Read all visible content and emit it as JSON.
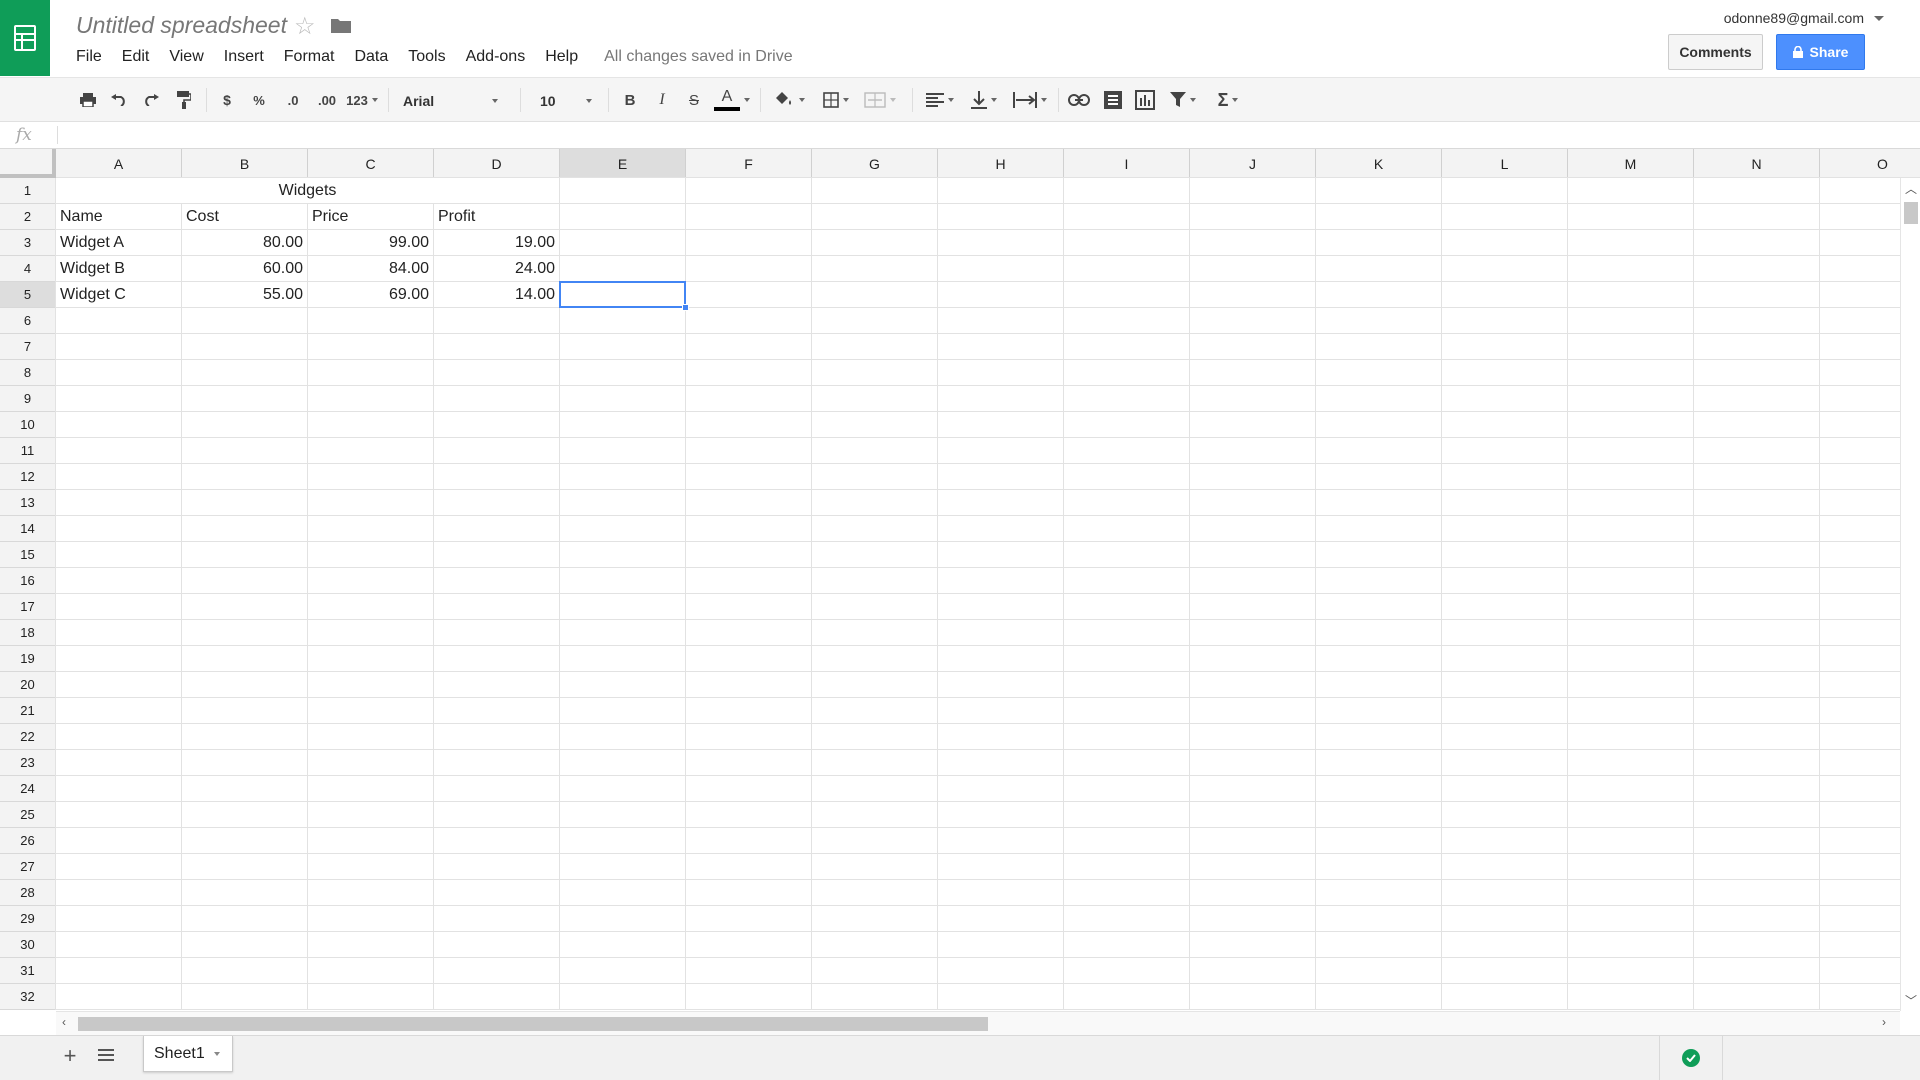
{
  "app": {
    "title": "Untitled spreadsheet",
    "save_status": "All changes saved in Drive",
    "account": "odonne89@gmail.com",
    "comments_label": "Comments",
    "share_label": "Share",
    "brand_color": "#0f9d58",
    "accent_color": "#4285f4"
  },
  "menu": [
    "File",
    "Edit",
    "View",
    "Insert",
    "Format",
    "Data",
    "Tools",
    "Add-ons",
    "Help"
  ],
  "toolbar": {
    "currency": "$",
    "percent": "%",
    "decrease_decimals": ".0",
    "increase_decimals": ".00",
    "more_formats": "123",
    "font": "Arial",
    "font_size": "10",
    "bold": "B",
    "italic": "I",
    "strike": "S",
    "text_color": "A",
    "sum": "Σ"
  },
  "formula_bar": {
    "label": "fx",
    "value": ""
  },
  "columns": [
    "A",
    "B",
    "C",
    "D",
    "E",
    "F",
    "G",
    "H",
    "I",
    "J",
    "K",
    "L",
    "M",
    "N",
    "O"
  ],
  "active_column": "E",
  "row_count": 32,
  "active_row": 5,
  "cells": {
    "title": "Widgets",
    "headers": [
      "Name",
      "Cost",
      "Price",
      "Profit"
    ],
    "rows": [
      [
        "Widget A",
        "80.00",
        "99.00",
        "19.00"
      ],
      [
        "Widget B",
        "60.00",
        "84.00",
        "24.00"
      ],
      [
        "Widget C",
        "55.00",
        "69.00",
        "14.00"
      ]
    ]
  },
  "sheets": [
    "Sheet1"
  ]
}
